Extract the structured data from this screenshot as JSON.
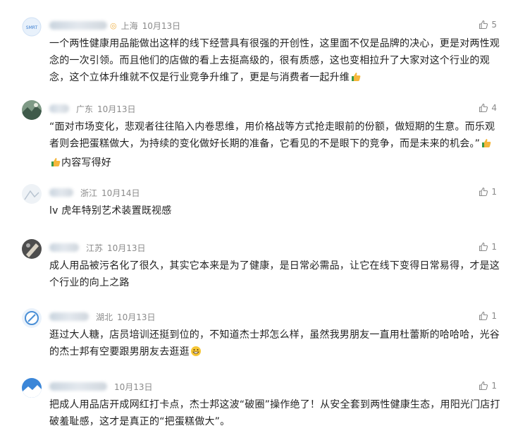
{
  "comments": [
    {
      "username": "Smartflow",
      "region": "上海",
      "date": "10月13日",
      "likes": "5",
      "text": "一个两性健康用品能做出这样的线下经营具有很强的开创性，这里面不仅是品牌的决心，更是对两性观念的一次引领。而且他们的店做的看上去挺高级的，很有质感，这也变相拉升了大家对这个行业的观念，这个立体升维就不仅是行业竞争升维了，更是与消费者一起升维",
      "avatar_color": "#3d7fd1"
    },
    {
      "username": "",
      "region": "广东",
      "date": "10月13日",
      "likes": "4",
      "text": "“面对市场变化，悲观者往往陷入内卷思维，用价格战等方式抢走眼前的份额，做短期的生意。而乐观者则会把蛋糕做大，为持续的变化做好长期的准备，它看见的不是眼下的竞争，而是未来的机会。”",
      "text_suffix": "内容写得好",
      "avatar_color": "#5a7a6a"
    },
    {
      "username": "",
      "region": "浙江",
      "date": "10月14日",
      "likes": "1",
      "text": "lv 虎年特别艺术装置既视感",
      "avatar_color": "#dfe6ee"
    },
    {
      "username": "",
      "region": "江苏",
      "date": "10月13日",
      "likes": "1",
      "text": "成人用品被污名化了很久，其实它本来是为了健康，是日常必需品，让它在线下变得日常易得，才是这个行业的向上之路",
      "avatar_color": "#6d6d6d"
    },
    {
      "username": "",
      "region": "湖北",
      "date": "10月13日",
      "likes": "1",
      "text": "逛过大人糖，店员培训还挺到位的，不知道杰士邦怎么样，虽然我男朋友一直用杜蕾斯的哈哈哈，光谷的杰士邦有空要跟男朋友去逛逛",
      "avatar_color": "#4a8fd6"
    },
    {
      "username": "",
      "region": "",
      "date": "10月13日",
      "likes": "1",
      "text": "把成人用品店开成网红打卡点，杰士邦这波“破圈”操作绝了！从安全套到两性健康生态，用阳光门店打破羞耻感，这才是真正的“把蛋糕做大”。",
      "avatar_color": "#3b86d8"
    }
  ],
  "colors": {
    "meta": "#8a8a8a",
    "text": "#222222",
    "vip": "#f0b34a"
  }
}
